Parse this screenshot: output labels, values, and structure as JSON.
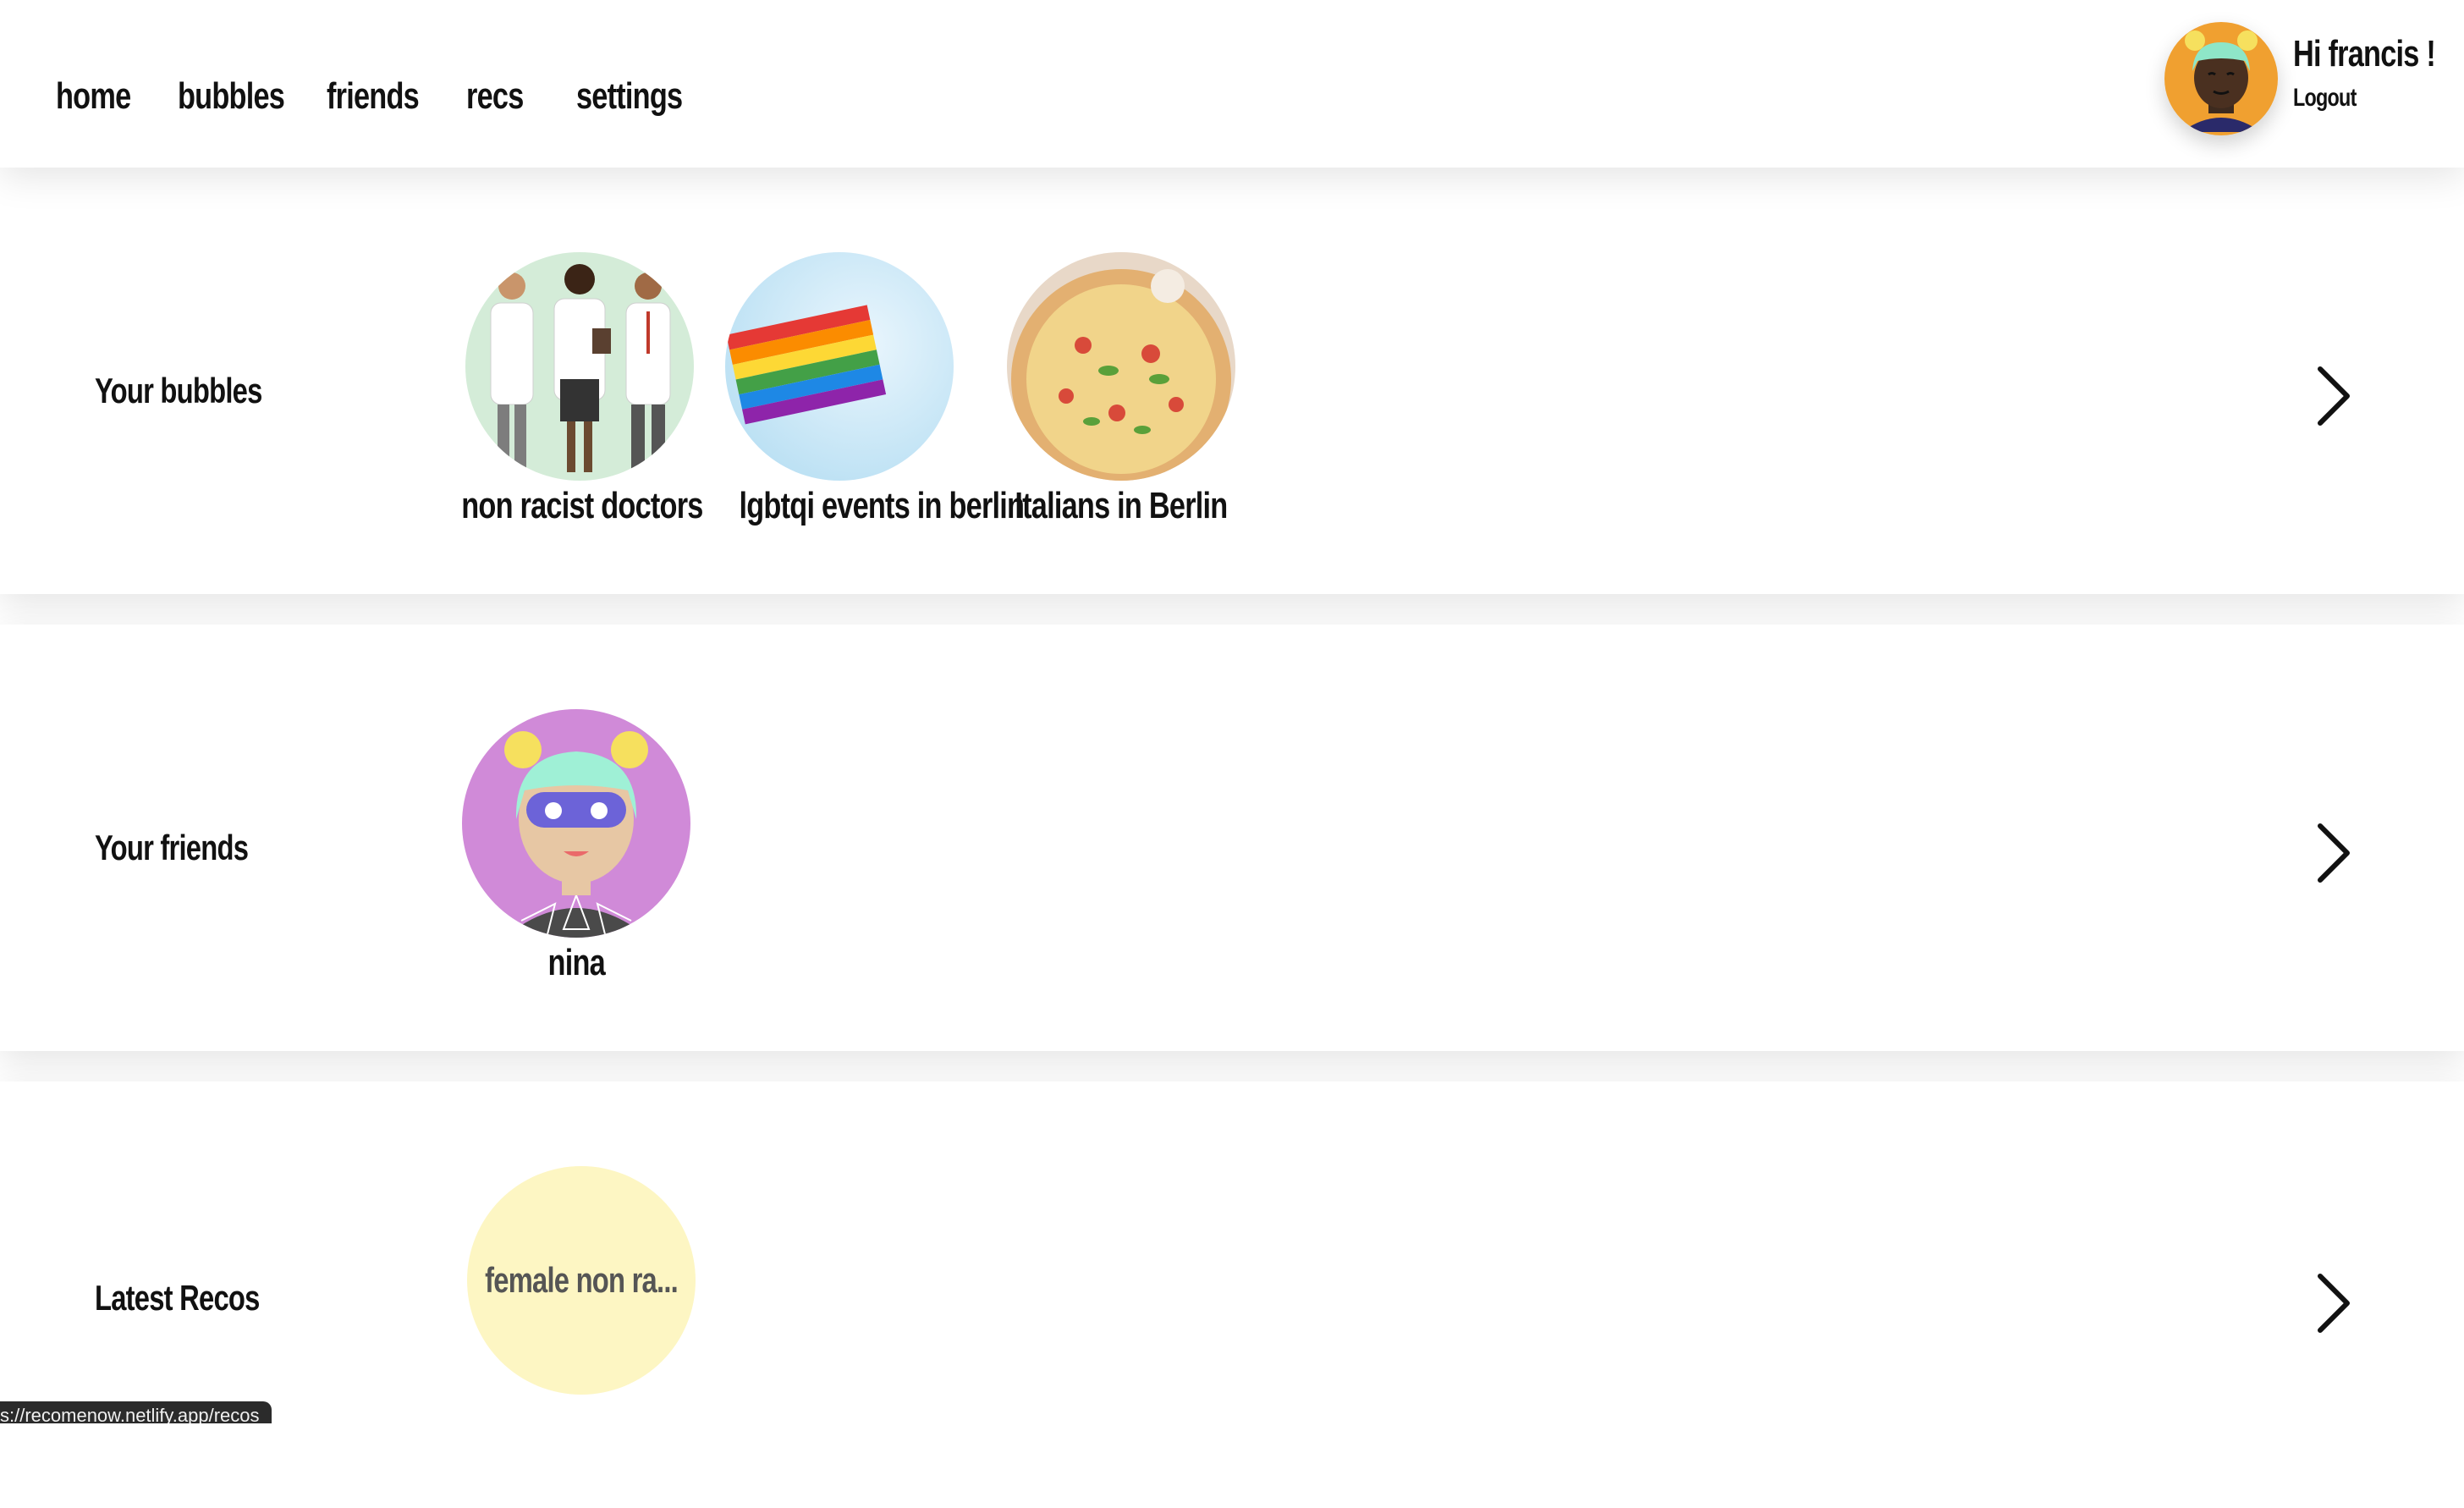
{
  "nav": {
    "items": [
      {
        "label": "home"
      },
      {
        "label": "bubbles"
      },
      {
        "label": "friends"
      },
      {
        "label": "recs"
      },
      {
        "label": "settings"
      }
    ]
  },
  "user": {
    "greeting": "Hi francis !",
    "logout_label": "Logout"
  },
  "sections": {
    "bubbles": {
      "title": "Your bubbles",
      "items": [
        {
          "label": "non racist doctors",
          "image": "doctors-illustration"
        },
        {
          "label": "lgbtqi events in berlin",
          "image": "rainbow-flag-photo"
        },
        {
          "label": "Italians in Berlin",
          "image": "pizza-photo"
        }
      ]
    },
    "friends": {
      "title": "Your friends",
      "items": [
        {
          "label": "nina",
          "image": "nina-avatar"
        }
      ]
    },
    "recos": {
      "title": "Latest Recos",
      "items": [
        {
          "label": "female non ra..."
        }
      ]
    }
  },
  "status_bar": {
    "url": "s://recomenow.netlify.app/recos"
  },
  "colors": {
    "header_bg": "#ffffff",
    "user_avatar_bg": "#f0a030",
    "friend_avatar_bg": "#d08ad8",
    "reco_bubble_bg": "#fdf6c3"
  }
}
